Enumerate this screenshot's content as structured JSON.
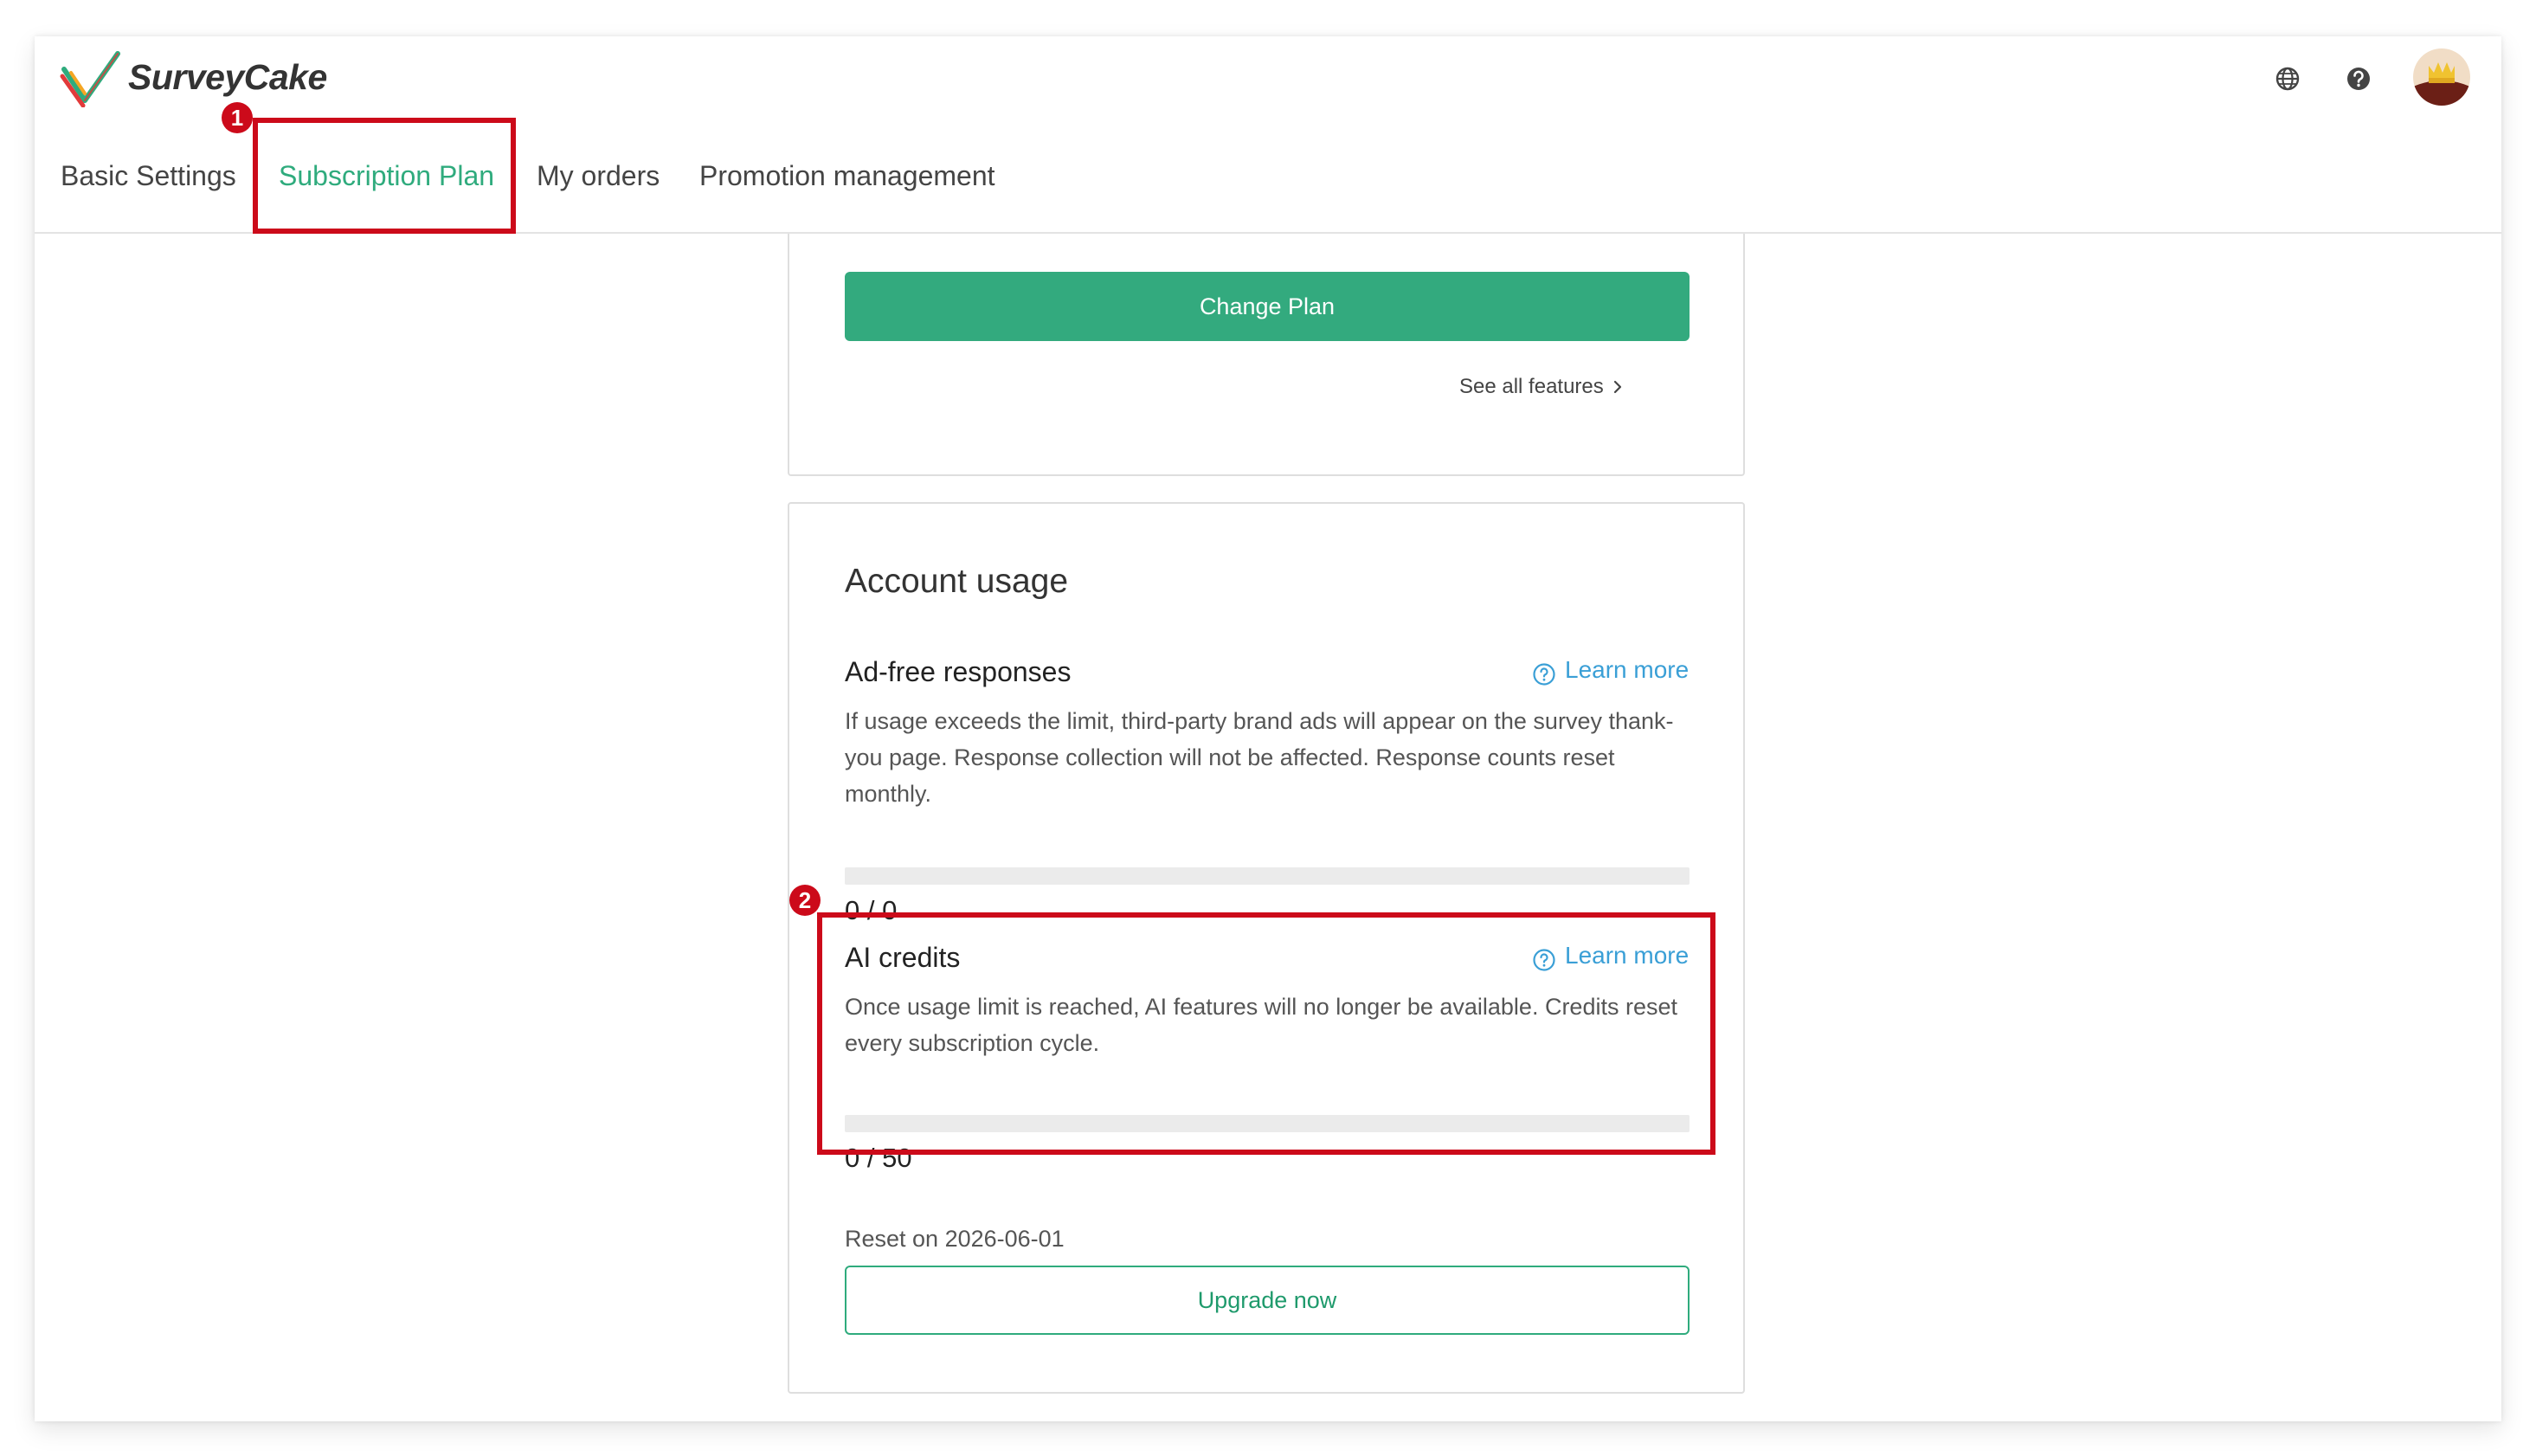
{
  "header": {
    "brand_name": "SurveyCake",
    "icons": [
      "globe-icon",
      "help-icon",
      "avatar"
    ]
  },
  "tabs": [
    {
      "label": "Basic Settings",
      "active": false
    },
    {
      "label": "Subscription Plan",
      "active": true
    },
    {
      "label": "My orders",
      "active": false
    },
    {
      "label": "Promotion management",
      "active": false
    }
  ],
  "annotations": {
    "marker_1": "1",
    "marker_2": "2"
  },
  "plan_card": {
    "change_plan_label": "Change Plan",
    "see_all_label": "See all features",
    "see_all_icon": "chevron-right-icon"
  },
  "usage_card": {
    "title": "Account usage",
    "ad_free": {
      "title": "Ad-free responses",
      "learn_more": "Learn more",
      "description": "If usage exceeds the limit, third-party brand ads will appear on the survey thank-you page. Response collection will not be affected. Response counts reset monthly.",
      "count": "0 / 0",
      "used": 0,
      "limit": 0
    },
    "ai_credits": {
      "title": "AI credits",
      "learn_more": "Learn more",
      "description": "Once usage limit is reached, AI features will no longer be available. Credits reset every subscription cycle.",
      "count": "0 / 50",
      "used": 0,
      "limit": 50
    },
    "reset_text": "Reset on 2026-06-01",
    "upgrade_label": "Upgrade now"
  },
  "colors": {
    "accent": "#2fab7d",
    "link": "#3a9fd6",
    "highlight": "#cc0a1a"
  }
}
